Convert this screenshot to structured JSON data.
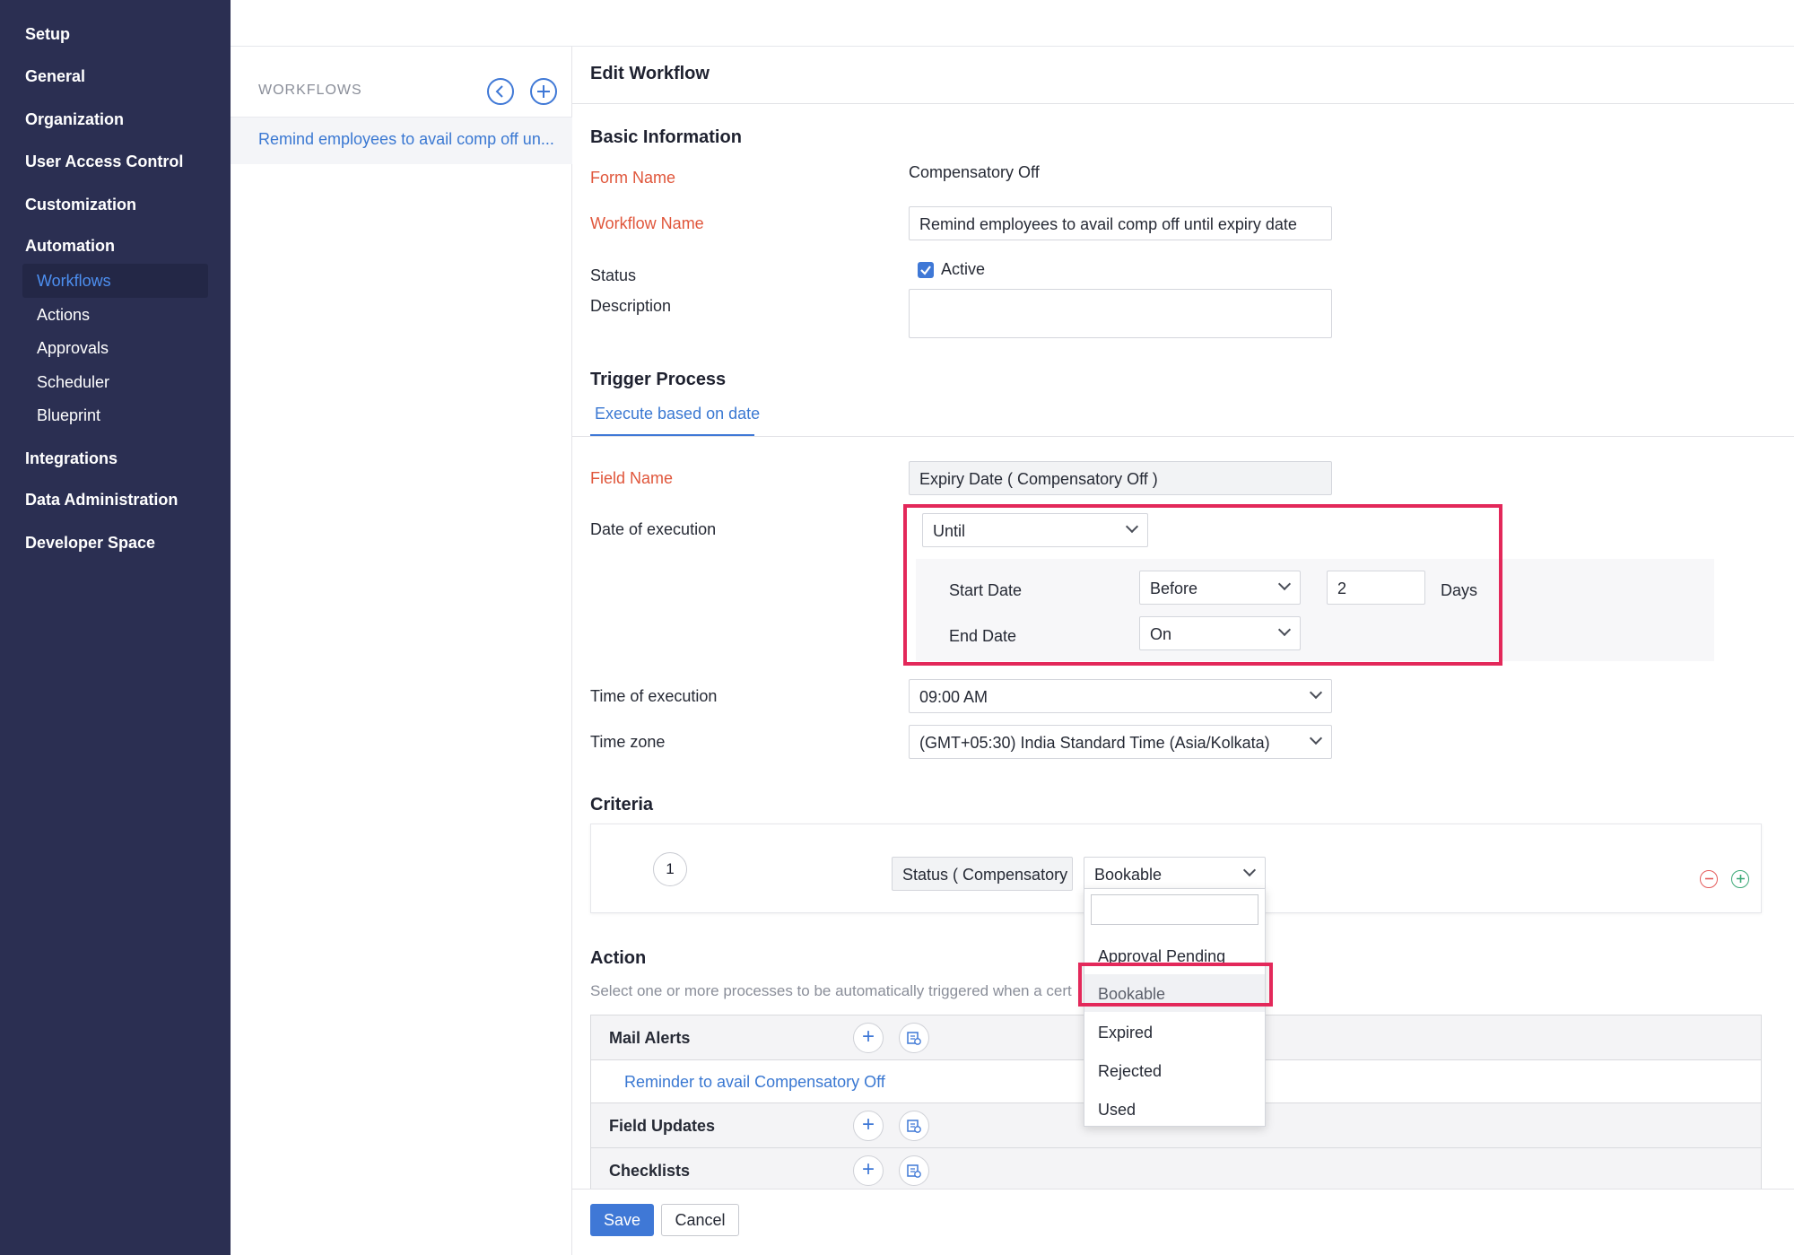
{
  "sidebar": {
    "items": [
      {
        "label": "Setup"
      },
      {
        "label": "General"
      },
      {
        "label": "Organization"
      },
      {
        "label": "User Access Control"
      },
      {
        "label": "Customization"
      },
      {
        "label": "Automation"
      },
      {
        "label": "Integrations"
      },
      {
        "label": "Data Administration"
      },
      {
        "label": "Developer Space"
      }
    ],
    "automation_subitems": [
      {
        "label": "Workflows",
        "active": true
      },
      {
        "label": "Actions"
      },
      {
        "label": "Approvals"
      },
      {
        "label": "Scheduler"
      },
      {
        "label": "Blueprint"
      }
    ]
  },
  "workflows_panel": {
    "heading": "WORKFLOWS",
    "back_icon": "chevron-left-circle-icon",
    "add_icon": "plus-circle-icon",
    "items": [
      {
        "label": "Remind employees to avail comp off un..."
      }
    ]
  },
  "editor": {
    "title": "Edit Workflow",
    "basic_info": {
      "heading": "Basic Information",
      "form_name_label": "Form Name",
      "form_name_value": "Compensatory Off",
      "workflow_name_label": "Workflow Name",
      "workflow_name_value": "Remind employees to avail comp off until expiry date",
      "status_label": "Status",
      "status_checkbox_label": "Active",
      "status_checked": true,
      "description_label": "Description",
      "description_value": ""
    },
    "trigger": {
      "heading": "Trigger Process",
      "tab_label": "Execute based on date",
      "field_name_label": "Field Name",
      "field_name_value": "Expiry Date ( Compensatory Off )",
      "date_of_execution_label": "Date of execution",
      "date_of_execution_value": "Until",
      "start_date_label": "Start Date",
      "start_date_value": "Before",
      "start_date_number": "2",
      "days_label": "Days",
      "end_date_label": "End Date",
      "end_date_value": "On",
      "time_label": "Time of execution",
      "time_value": "09:00 AM",
      "timezone_label": "Time zone",
      "timezone_value": "(GMT+05:30) India Standard Time (Asia/Kolkata)"
    },
    "criteria": {
      "heading": "Criteria",
      "row_number": "1",
      "field_value": "Status ( Compensatory",
      "selected_value": "Bookable",
      "remove_icon": "minus-circle-icon",
      "add_icon": "plus-circle-icon",
      "dropdown_search": "",
      "dropdown_options": [
        "Approval Pending",
        "Bookable",
        "Expired",
        "Rejected",
        "Used"
      ],
      "dropdown_selected_index": 1
    },
    "action": {
      "heading": "Action",
      "description": "Select one or more processes to be automatically triggered when a cert",
      "rows": [
        {
          "label": "Mail Alerts",
          "link": "Reminder to avail Compensatory Off"
        },
        {
          "label": "Field Updates"
        },
        {
          "label": "Checklists"
        }
      ],
      "add_icon": "plus-icon",
      "associate_icon": "associate-existing-icon"
    },
    "footer": {
      "save_label": "Save",
      "cancel_label": "Cancel"
    }
  },
  "colors": {
    "sidebar_bg": "#2b2f52",
    "accent": "#3f78d6",
    "required_label": "#e0563b",
    "highlight": "#e3285a"
  }
}
